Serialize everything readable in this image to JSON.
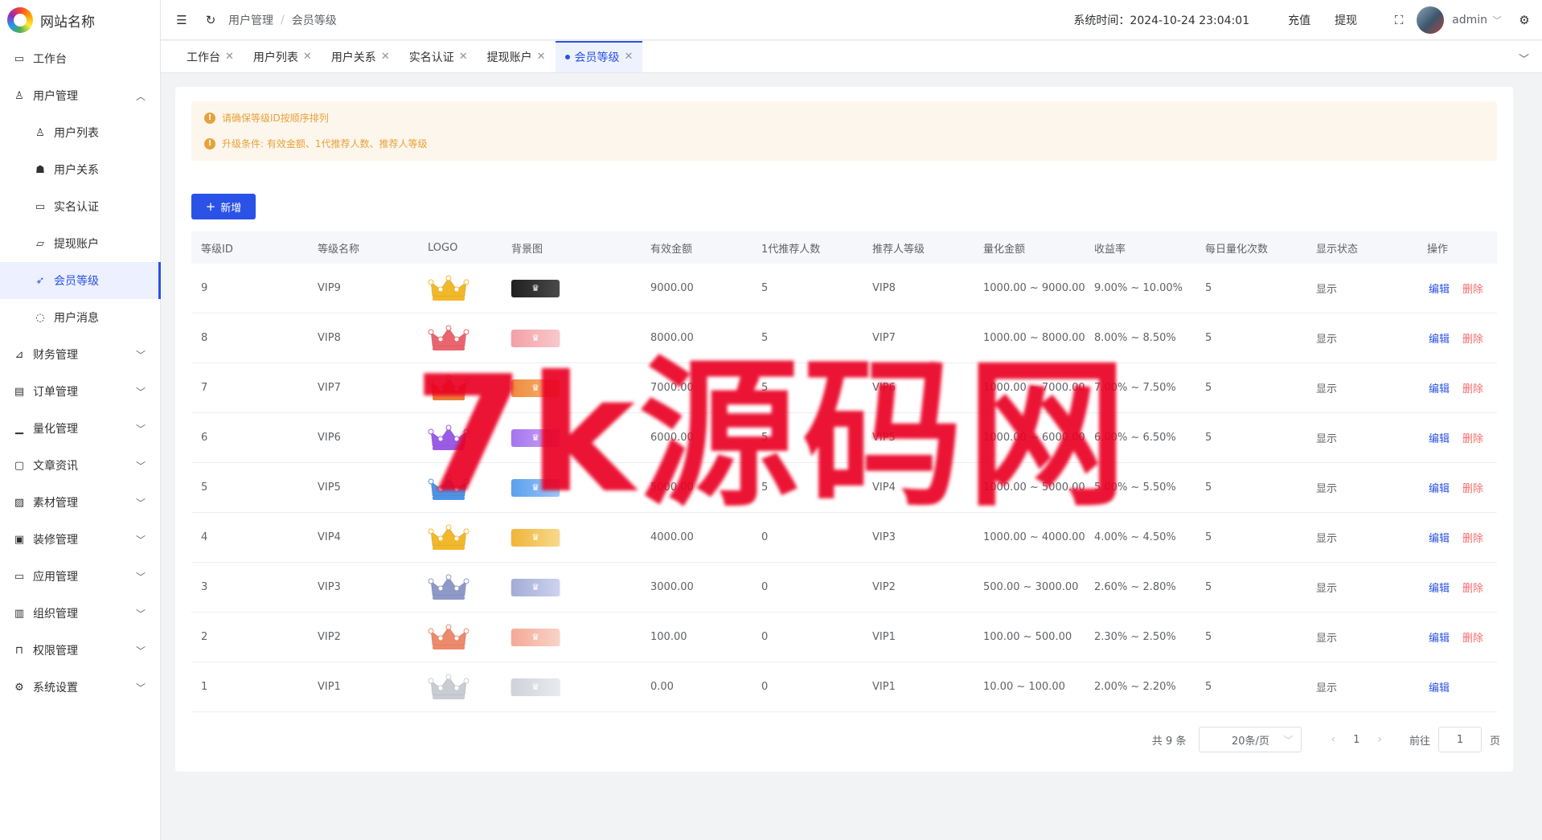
{
  "brand": {
    "name": "网站名称"
  },
  "sidebar": {
    "items": [
      {
        "label": "工作台",
        "icon": "monitor-icon",
        "glyph": "▭",
        "level": 1,
        "arrow": ""
      },
      {
        "label": "用户管理",
        "icon": "user-icon",
        "glyph": "♙",
        "level": 1,
        "arrow": "︿"
      },
      {
        "label": "用户列表",
        "icon": "user-list-icon",
        "glyph": "♙",
        "level": 2,
        "arrow": ""
      },
      {
        "label": "用户关系",
        "icon": "users-icon",
        "glyph": "☗",
        "level": 2,
        "arrow": ""
      },
      {
        "label": "实名认证",
        "icon": "id-card-icon",
        "glyph": "▭",
        "level": 2,
        "arrow": ""
      },
      {
        "label": "提现账户",
        "icon": "folder-icon",
        "glyph": "▱",
        "level": 2,
        "arrow": ""
      },
      {
        "label": "会员等级",
        "icon": "rocket-icon",
        "glyph": "➶",
        "level": 2,
        "arrow": "",
        "active": true
      },
      {
        "label": "用户消息",
        "icon": "message-icon",
        "glyph": "◌",
        "level": 2,
        "arrow": ""
      },
      {
        "label": "财务管理",
        "icon": "chart-icon",
        "glyph": "⊿",
        "level": 1,
        "arrow": "﹀"
      },
      {
        "label": "订单管理",
        "icon": "order-icon",
        "glyph": "▤",
        "level": 1,
        "arrow": "﹀"
      },
      {
        "label": "量化管理",
        "icon": "quant-icon",
        "glyph": "▁",
        "level": 1,
        "arrow": "﹀"
      },
      {
        "label": "文章资讯",
        "icon": "article-icon",
        "glyph": "▢",
        "level": 1,
        "arrow": "﹀"
      },
      {
        "label": "素材管理",
        "icon": "picture-icon",
        "glyph": "▨",
        "level": 1,
        "arrow": "﹀"
      },
      {
        "label": "装修管理",
        "icon": "decorate-icon",
        "glyph": "▣",
        "level": 1,
        "arrow": "﹀"
      },
      {
        "label": "应用管理",
        "icon": "app-icon",
        "glyph": "▭",
        "level": 1,
        "arrow": "﹀"
      },
      {
        "label": "组织管理",
        "icon": "org-icon",
        "glyph": "▥",
        "level": 1,
        "arrow": "﹀"
      },
      {
        "label": "权限管理",
        "icon": "lock-icon",
        "glyph": "⊓",
        "level": 1,
        "arrow": "﹀"
      },
      {
        "label": "系统设置",
        "icon": "gear-icon",
        "glyph": "⚙",
        "level": 1,
        "arrow": "﹀"
      }
    ]
  },
  "header": {
    "breadcrumb": [
      "用户管理",
      "会员等级"
    ],
    "system_time": "系统时间：2024-10-24 23:04:01",
    "recharge_label": "充值",
    "withdraw_label": "提现",
    "user_name": "admin"
  },
  "tabs": [
    {
      "label": "工作台",
      "active": false
    },
    {
      "label": "用户列表",
      "active": false
    },
    {
      "label": "用户关系",
      "active": false
    },
    {
      "label": "实名认证",
      "active": false
    },
    {
      "label": "提现账户",
      "active": false
    },
    {
      "label": "会员等级",
      "active": true
    }
  ],
  "alerts": [
    "请确保等级ID按顺序排列",
    "升级条件: 有效金额、1代推荐人数、推荐人等级"
  ],
  "add_button_label": "新增",
  "table": {
    "columns": [
      "等级ID",
      "等级名称",
      "LOGO",
      "背景图",
      "有效金额",
      "1代推荐人数",
      "推荐人等级",
      "量化金额",
      "收益率",
      "每日量化次数",
      "显示状态",
      "操作"
    ],
    "edit_label": "编辑",
    "delete_label": "删除",
    "rows": [
      {
        "id": "9",
        "name": "VIP9",
        "crown": "#f2b82b",
        "bg": [
          "#1f1f1f",
          "#4a4a4a"
        ],
        "amount": "9000.00",
        "referrals": "5",
        "ref_level": "VIP8",
        "quant": "1000.00 ~ 9000.00",
        "rate": "9.00% ~ 10.00%",
        "daily": "5",
        "status": "显示",
        "deletable": true
      },
      {
        "id": "8",
        "name": "VIP8",
        "crown": "#e9656d",
        "bg": [
          "#f4a0a6",
          "#f7c9cc"
        ],
        "amount": "8000.00",
        "referrals": "5",
        "ref_level": "VIP7",
        "quant": "1000.00 ~ 8000.00",
        "rate": "8.00% ~ 8.50%",
        "daily": "5",
        "status": "显示",
        "deletable": true
      },
      {
        "id": "7",
        "name": "VIP7",
        "crown": "#ef7a3b",
        "bg": [
          "#f08a3e",
          "#f6b678"
        ],
        "amount": "7000.00",
        "referrals": "5",
        "ref_level": "VIP6",
        "quant": "1000.00 ~ 7000.00",
        "rate": "7.00% ~ 7.50%",
        "daily": "5",
        "status": "显示",
        "deletable": true
      },
      {
        "id": "6",
        "name": "VIP6",
        "crown": "#9a5ce6",
        "bg": [
          "#a574ee",
          "#c9a9f6"
        ],
        "amount": "6000.00",
        "referrals": "5",
        "ref_level": "VIP5",
        "quant": "1000.00 ~ 6000.00",
        "rate": "6.00% ~ 6.50%",
        "daily": "5",
        "status": "显示",
        "deletable": true
      },
      {
        "id": "5",
        "name": "VIP5",
        "crown": "#4d94e6",
        "bg": [
          "#5aa0ee",
          "#9cc6f7"
        ],
        "amount": "5000.00",
        "referrals": "5",
        "ref_level": "VIP4",
        "quant": "1000.00 ~ 5000.00",
        "rate": "5.00% ~ 5.50%",
        "daily": "5",
        "status": "显示",
        "deletable": true
      },
      {
        "id": "4",
        "name": "VIP4",
        "crown": "#f2b82b",
        "bg": [
          "#f0b43a",
          "#f7d98a"
        ],
        "amount": "4000.00",
        "referrals": "0",
        "ref_level": "VIP3",
        "quant": "1000.00 ~ 4000.00",
        "rate": "4.00% ~ 4.50%",
        "daily": "5",
        "status": "显示",
        "deletable": true
      },
      {
        "id": "3",
        "name": "VIP3",
        "crown": "#8d99c8",
        "bg": [
          "#a3acd6",
          "#ccd2ee"
        ],
        "amount": "3000.00",
        "referrals": "0",
        "ref_level": "VIP2",
        "quant": "500.00 ~ 3000.00",
        "rate": "2.60% ~ 2.80%",
        "daily": "5",
        "status": "显示",
        "deletable": true
      },
      {
        "id": "2",
        "name": "VIP2",
        "crown": "#ec8a6c",
        "bg": [
          "#f4a996",
          "#f9d2c7"
        ],
        "amount": "100.00",
        "referrals": "0",
        "ref_level": "VIP1",
        "quant": "100.00 ~ 500.00",
        "rate": "2.30% ~ 2.50%",
        "daily": "5",
        "status": "显示",
        "deletable": true
      },
      {
        "id": "1",
        "name": "VIP1",
        "crown": "#c9ccd3",
        "bg": [
          "#cfd2d8",
          "#e8eaee"
        ],
        "amount": "0.00",
        "referrals": "0",
        "ref_level": "VIP1",
        "quant": "10.00 ~ 100.00",
        "rate": "2.00% ~ 2.20%",
        "daily": "5",
        "status": "显示",
        "deletable": false
      }
    ]
  },
  "pagination": {
    "total": "共 9 条",
    "page_size": "20条/页",
    "current_page": "1",
    "goto_label": "前往",
    "goto_value": "1",
    "page_suffix": "页"
  },
  "watermark": "7k源码网",
  "colors": {
    "accent": "#2b52e6",
    "danger": "#f56c6c",
    "warning": "#e6a23c",
    "watermark": "#e90023"
  }
}
